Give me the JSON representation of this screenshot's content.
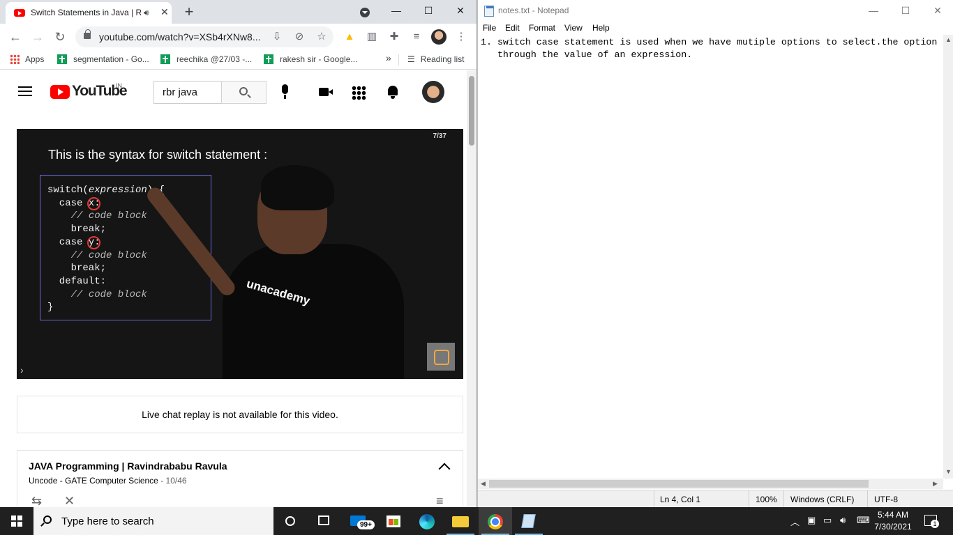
{
  "chrome": {
    "tab": {
      "title": "Switch Statements in Java | R",
      "close": "✕"
    },
    "new_tab": "+",
    "window_controls": {
      "minimize": "—",
      "maximize": "☐",
      "close": "✕"
    },
    "url": "youtube.com/watch?v=XSb4rXNw8...",
    "bookmarks": [
      {
        "label": "Apps"
      },
      {
        "label": "segmentation - Go..."
      },
      {
        "label": "reechika @27/03 -..."
      },
      {
        "label": "rakesh sir - Google..."
      }
    ],
    "bookmarks_more": "»",
    "reading_list": "Reading list"
  },
  "youtube": {
    "logo_text": "YouTube",
    "region": "IN",
    "search_value": "rbr java",
    "video": {
      "counter": "7/37",
      "slide_title": "This is the syntax for switch statement :",
      "brand": "unacademy"
    },
    "live_chat": "Live chat replay is not available for this video.",
    "playlist": {
      "title": "JAVA Programming | Ravindrababu Ravula",
      "channel": "Uncode - GATE Computer Science",
      "separator": " - ",
      "position": "10/46"
    }
  },
  "notepad": {
    "title": "notes.txt - Notepad",
    "menu": [
      "File",
      "Edit",
      "Format",
      "View",
      "Help"
    ],
    "text": "1. switch case statement is used when we have mutiple options to select.the option\n   through the value of an expression.",
    "status": {
      "position": "Ln 4, Col 1",
      "zoom": "100%",
      "line_ending": "Windows (CRLF)",
      "encoding": "UTF-8"
    }
  },
  "taskbar": {
    "search_placeholder": "Type here to search",
    "mail_badge": "99+",
    "time": "5:44 AM",
    "date": "7/30/2021",
    "notifications": "1"
  }
}
